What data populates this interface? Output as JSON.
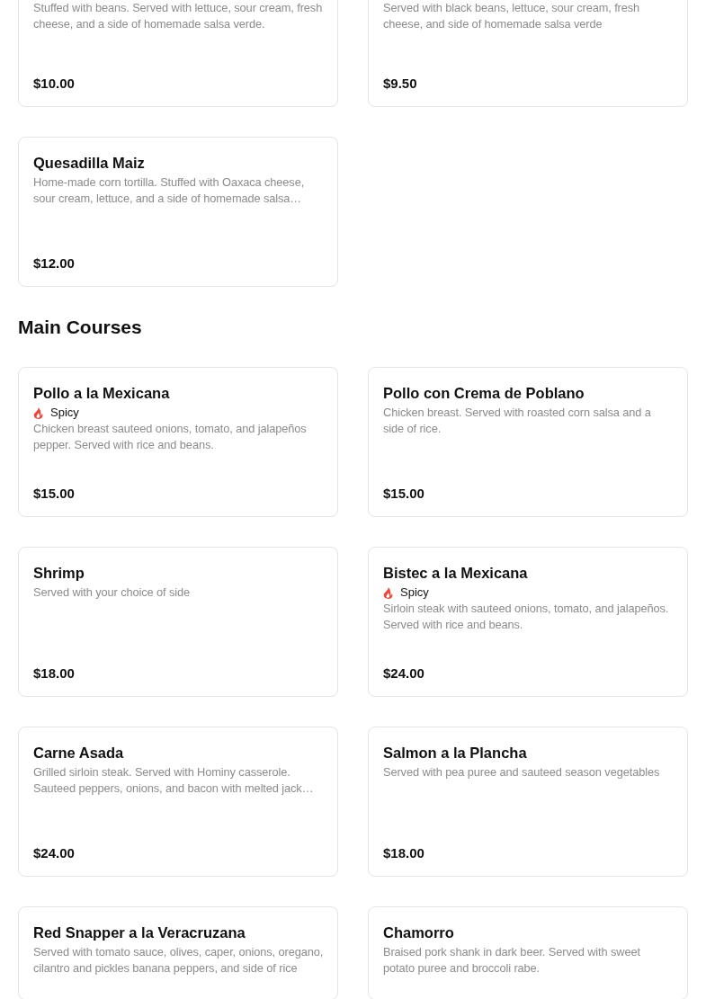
{
  "sections": [
    {
      "items": [
        {
          "description": "Stuffed with beans. Served with lettuce, sour cream, fresh cheese, and a side of homemade salsa verde.",
          "price": "$10.00"
        },
        {
          "description": "Served with black beans, lettuce, sour cream, fresh cheese, and side of homemade salsa verde",
          "price": "$9.50"
        },
        {
          "name": "Quesadilla Maiz",
          "description": "Home-made corn tortilla. Stuffed with Oaxaca cheese, sour cream, lettuce, and a side of homemade salsa…",
          "price": "$12.00"
        }
      ]
    },
    {
      "title": "Main Courses",
      "items": [
        {
          "name": "Pollo a la Mexicana",
          "tag": "Spicy",
          "description": "Chicken breast sauteed onions, tomato, and jalapeños pepper. Served with rice and beans.",
          "price": "$15.00"
        },
        {
          "name": "Pollo con Crema de Poblano",
          "description": "Chicken breast. Served with roasted corn salsa and a side of rice.",
          "price": "$15.00"
        },
        {
          "name": "Shrimp",
          "description": "Served with your choice of side",
          "price": "$18.00"
        },
        {
          "name": "Bistec a la Mexicana",
          "tag": "Spicy",
          "description": "Sirloin steak with sauteed onions, tomato, and jalapeños. Served with rice and beans.",
          "price": "$24.00"
        },
        {
          "name": "Carne Asada",
          "description": "Grilled sirloin steak. Served with Hominy casserole. Sauteed peppers, onions, and bacon with melted jack…",
          "price": "$24.00"
        },
        {
          "name": "Salmon a la Plancha",
          "description": "Served with pea puree and sauteed season vegetables",
          "price": "$18.00"
        },
        {
          "name": "Red Snapper a la Veracruzana",
          "description": "Served with tomato sauce, olives, caper, onions, oregano, cilantro and pickles banana peppers, and side of rice"
        },
        {
          "name": "Chamorro",
          "description": "Braised pork shank in dark beer. Served with sweet potato puree and broccoli rabe."
        }
      ]
    }
  ]
}
